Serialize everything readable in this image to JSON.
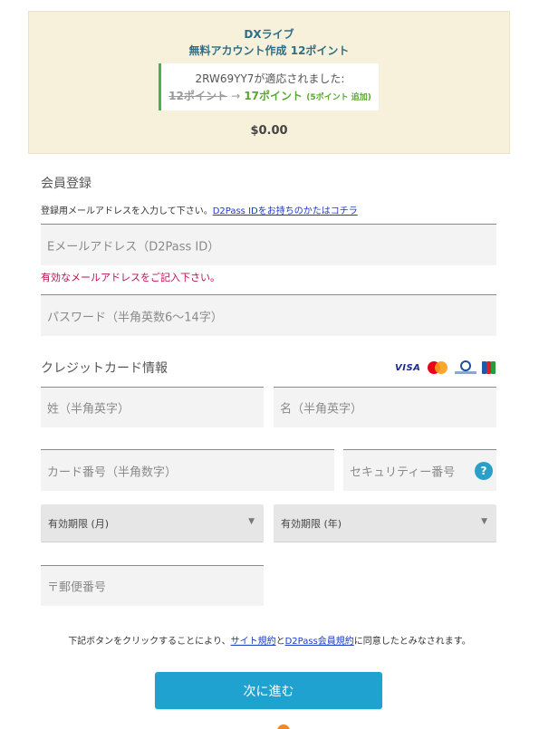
{
  "summary": {
    "title": "DXライブ",
    "subtitle": "無料アカウント作成 12ポイント",
    "promo": {
      "code_message": "2RW69YY7が適応されました:",
      "old_points": "12ポイント",
      "arrow": "→",
      "new_points": "17ポイント",
      "bonus": "(5ポイント 追加)",
      "accent_color": "#4caf50"
    },
    "price": "$0.00"
  },
  "registration": {
    "title": "会員登録",
    "helper_text": "登録用メールアドレスを入力して下さい。",
    "helper_link": "D2Pass IDをお持ちのかたはコチラ",
    "email_placeholder": "Eメールアドレス（D2Pass ID）",
    "email_error": "有効なメールアドレスをご記入下さい。",
    "password_placeholder": "パスワード（半角英数6～14字）"
  },
  "credit_card": {
    "title": "クレジットカード情報",
    "brand_visa": "VISA",
    "brand_icons": [
      "visa-icon",
      "mastercard-icon",
      "diners-club-icon",
      "jcb-icon"
    ],
    "last_name_placeholder": "姓（半角英字）",
    "first_name_placeholder": "名（半角英字）",
    "card_number_placeholder": "カード番号（半角数字）",
    "security_code_placeholder": "セキュリティー番号",
    "help_label": "?",
    "exp_month_label": "有効期限 (月)",
    "exp_year_label": "有効期限 (年)",
    "chevron": "▼",
    "postal_code_placeholder": "〒郵便番号"
  },
  "terms": {
    "prefix": "下記ボタンをクリックすることにより、",
    "link1": "サイト規約",
    "middle": "と",
    "link2": "D2Pass会員規約",
    "suffix": "に同意したとみなされます。"
  },
  "actions": {
    "next_label": "次に進む",
    "button_color": "#1fa2cf"
  }
}
